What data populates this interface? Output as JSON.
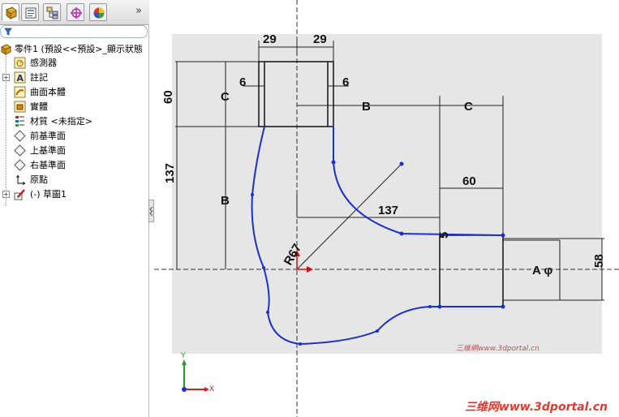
{
  "tabs": [
    {
      "name": "featuremanager",
      "icon": "featuremanager-icon"
    },
    {
      "name": "propertymanager",
      "icon": "propertymanager-icon"
    },
    {
      "name": "configurationmanager",
      "icon": "configurationmanager-icon"
    },
    {
      "name": "dimxpertmanager",
      "icon": "dimxpert-icon"
    },
    {
      "name": "displaymanager",
      "icon": "displaymanager-icon"
    }
  ],
  "tab_more": "»",
  "tree": {
    "root": "零件1 (預設<<預設>_顯示狀態",
    "items": [
      {
        "label": "感測器",
        "icon": "sensor-icon",
        "expandable": false
      },
      {
        "label": "註記",
        "icon": "annotation-icon",
        "expandable": true
      },
      {
        "label": "曲面本體",
        "icon": "surface-bodies-icon",
        "expandable": false
      },
      {
        "label": "實體",
        "icon": "solid-bodies-icon",
        "expandable": false
      },
      {
        "label": "材質 <未指定>",
        "icon": "material-icon",
        "expandable": false
      },
      {
        "label": "前基準面",
        "icon": "plane-icon",
        "expandable": false
      },
      {
        "label": "上基準面",
        "icon": "plane-icon",
        "expandable": false
      },
      {
        "label": "右基準面",
        "icon": "plane-icon",
        "expandable": false
      },
      {
        "label": "原點",
        "icon": "origin-icon",
        "expandable": false
      },
      {
        "label": "(-) 草圖1",
        "icon": "sketch-icon",
        "expandable": true
      }
    ]
  },
  "drawing": {
    "dims": {
      "top_w1": "29",
      "top_w2": "29",
      "wall_l": "6",
      "wall_r": "6",
      "h60": "60",
      "c_left": "C",
      "b_top": "B",
      "c_top": "C",
      "h137": "137",
      "b_left": "B",
      "w60": "60",
      "h137_horiz": "137",
      "r67": "R67",
      "a_dia": "A φ",
      "d58": "58",
      "five": "5"
    },
    "watermark_small": "三維網www.3dportal.cn"
  },
  "triad": {
    "x": "X",
    "y": "Y"
  },
  "watermark": "三维网www.3dportal.cn",
  "colors": {
    "sketch_blue": "#1a2fcc",
    "accent_red": "#e03a30"
  }
}
